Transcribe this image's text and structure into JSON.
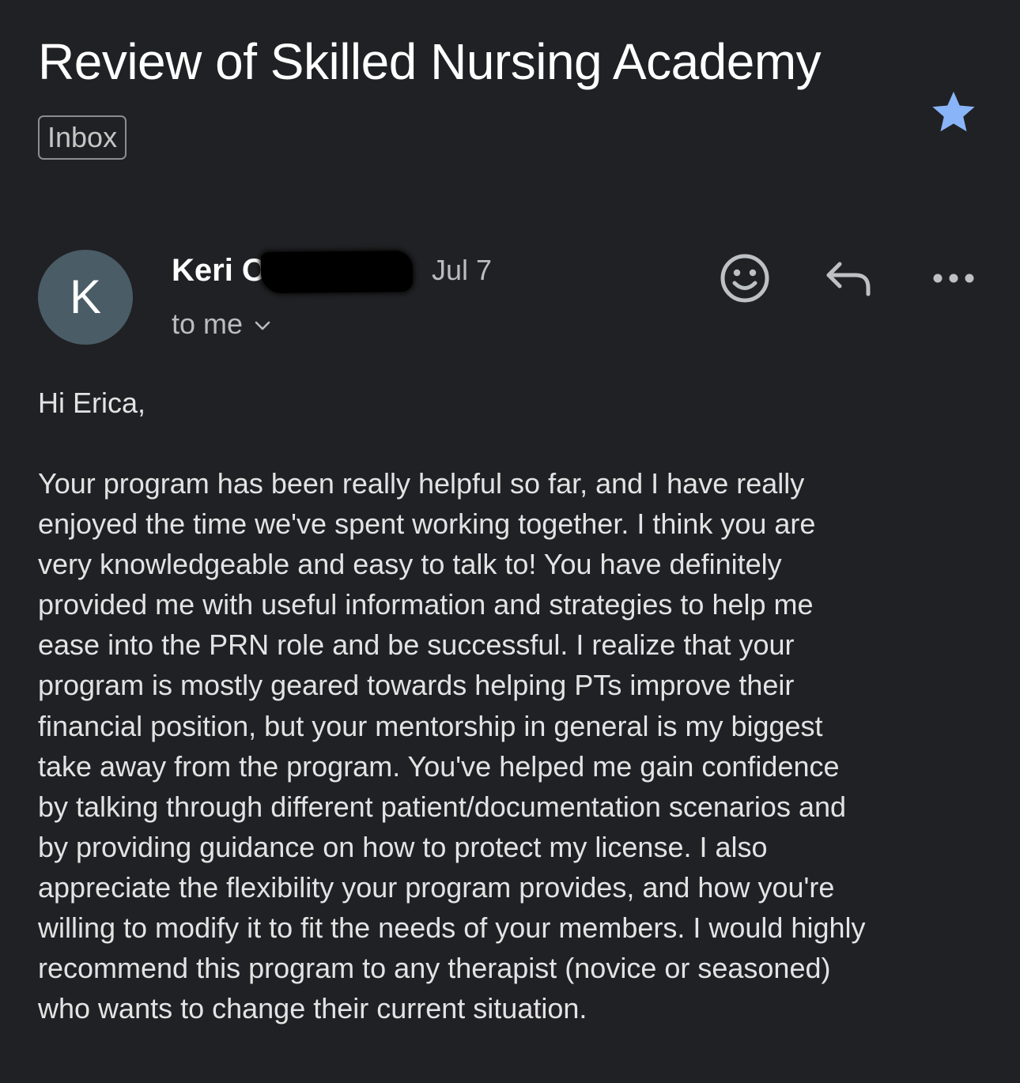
{
  "email": {
    "subject": "Review of Skilled Nursing Academy",
    "label": "Inbox",
    "starred": true,
    "sender": {
      "avatar_letter": "K",
      "name_visible": "Keri O",
      "date": "Jul 7",
      "recipient": "to me"
    },
    "greeting": "Hi Erica,",
    "body_lines": [
      "Your program has been really helpful so far, and I have really",
      "enjoyed the time we've spent working together. I think you are",
      "very knowledgeable and easy to talk to! You have definitely",
      "provided me with useful information and strategies to help me",
      "ease into the PRN role and be successful. I realize that your",
      "program is mostly geared towards helping PTs improve their",
      "financial position, but your mentorship in general is my biggest",
      "take away from the program. You've helped me gain confidence",
      "by talking through different patient/documentation scenarios and",
      "by providing guidance on how to protect my license. I also",
      "appreciate the flexibility your program provides, and how you're",
      "willing to modify it to fit the needs of your members. I would highly",
      "recommend this program to any therapist (novice or seasoned)",
      "who wants to change their current situation."
    ]
  },
  "icons": {
    "star": "star-icon",
    "emoji": "emoji-reaction-icon",
    "reply": "reply-icon",
    "more": "more-options-icon",
    "expand": "chevron-down-icon"
  },
  "colors": {
    "background": "#202124",
    "star": "#8ab4f8",
    "avatar": "#4a5c66",
    "text_primary": "#ffffff",
    "text_secondary": "#b9bcc0"
  }
}
